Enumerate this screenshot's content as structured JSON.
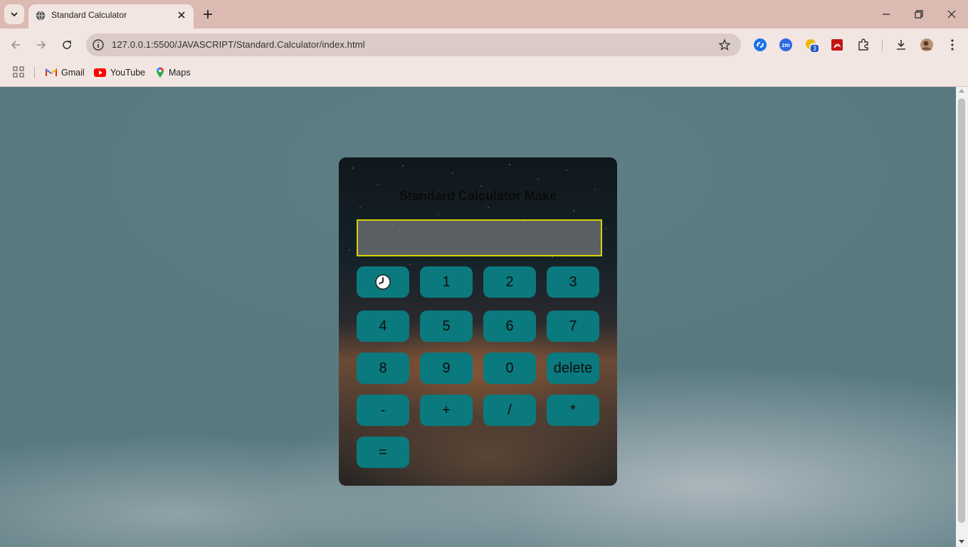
{
  "browser": {
    "tab_title": "Standard Calculator",
    "url": "127.0.0.1:5500/JAVASCRIPT/Standard.Calculator/index.html",
    "extension_badge": "3",
    "bookmarks": [
      {
        "label": "Gmail",
        "icon": "gmail-icon"
      },
      {
        "label": "YouTube",
        "icon": "youtube-icon"
      },
      {
        "label": "Maps",
        "icon": "maps-icon"
      }
    ]
  },
  "calculator": {
    "title": "Standard Calculator Make",
    "display_value": "",
    "keys": [
      {
        "label": "🕓",
        "name": "history-key"
      },
      {
        "label": "1",
        "name": "key-1"
      },
      {
        "label": "2",
        "name": "key-2"
      },
      {
        "label": "3",
        "name": "key-3"
      },
      {
        "label": "4",
        "name": "key-4"
      },
      {
        "label": "5",
        "name": "key-5"
      },
      {
        "label": "6",
        "name": "key-6"
      },
      {
        "label": "7",
        "name": "key-7"
      },
      {
        "label": "8",
        "name": "key-8"
      },
      {
        "label": "9",
        "name": "key-9"
      },
      {
        "label": "0",
        "name": "key-0"
      },
      {
        "label": "delete",
        "name": "delete-key"
      },
      {
        "label": "-",
        "name": "minus-key"
      },
      {
        "label": "+",
        "name": "plus-key"
      },
      {
        "label": "/",
        "name": "divide-key"
      },
      {
        "label": "*",
        "name": "multiply-key"
      },
      {
        "label": "=",
        "name": "equals-key"
      }
    ]
  },
  "colors": {
    "key_background": "#0a7a7e",
    "display_border": "#d7d200",
    "tab_strip": "#dbbab2"
  }
}
